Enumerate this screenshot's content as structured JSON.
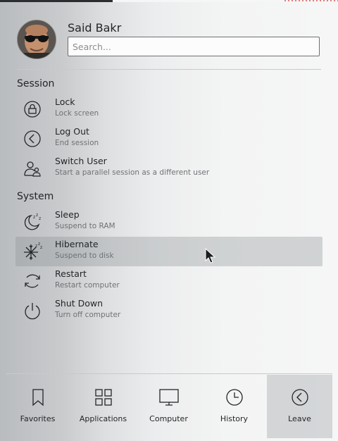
{
  "user": {
    "name": "Said Bakr"
  },
  "search": {
    "placeholder": "Search..."
  },
  "sections": {
    "session": "Session",
    "system": "System"
  },
  "session_items": [
    {
      "title": "Lock",
      "desc": "Lock screen",
      "icon": "lock-icon"
    },
    {
      "title": "Log Out",
      "desc": "End session",
      "icon": "logout-icon"
    },
    {
      "title": "Switch User",
      "desc": "Start a parallel session as a different user",
      "icon": "switch-user-icon"
    }
  ],
  "system_items": [
    {
      "title": "Sleep",
      "desc": "Suspend to RAM",
      "icon": "sleep-icon"
    },
    {
      "title": "Hibernate",
      "desc": "Suspend to disk",
      "icon": "hibernate-icon",
      "highlighted": true
    },
    {
      "title": "Restart",
      "desc": "Restart computer",
      "icon": "restart-icon"
    },
    {
      "title": "Shut Down",
      "desc": "Turn off computer",
      "icon": "power-icon"
    }
  ],
  "tabs": [
    {
      "label": "Favorites",
      "icon": "bookmark-icon"
    },
    {
      "label": "Applications",
      "icon": "grid-icon"
    },
    {
      "label": "Computer",
      "icon": "monitor-icon"
    },
    {
      "label": "History",
      "icon": "clock-icon"
    },
    {
      "label": "Leave",
      "icon": "chevron-left-circle-icon",
      "active": true
    }
  ],
  "colors": {
    "text": "#232627",
    "subtext": "#6f7275",
    "highlight": "#b4b8bb"
  }
}
